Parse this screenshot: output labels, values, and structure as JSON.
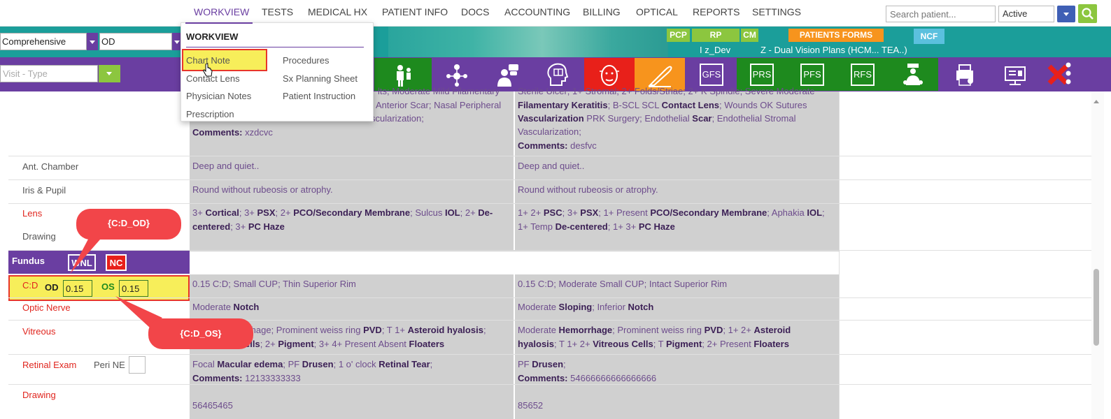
{
  "nav": {
    "items": [
      "WORKVIEW",
      "TESTS",
      "MEDICAL HX",
      "PATIENT INFO",
      "DOCS",
      "ACCOUNTING",
      "BILLING",
      "OPTICAL",
      "REPORTS",
      "SETTINGS"
    ],
    "search_placeholder": "Search patient...",
    "status_value": "Active"
  },
  "header": {
    "exam_type": "Comprehensive",
    "eye": "OD",
    "badges": {
      "pcp": "PCP",
      "rp": "RP",
      "cm": "CM",
      "forms": "PATIENTS FORMS",
      "ncf": "NCF"
    },
    "provider": "I z_Dev",
    "plan": "Z - Dual Vision Plans (HCM... TEA..)",
    "visit_type_placeholder": "Visit - Type"
  },
  "toolbar": {
    "gfs": "GFS",
    "prs": "PRS",
    "pfs": "PFS",
    "rfs": "RFS",
    "colors": {
      "green": "#1e8a1e",
      "red": "#e8201a",
      "orange": "#f7941d",
      "purple": "#6a3ea1"
    }
  },
  "dropdown": {
    "title": "WORKVIEW",
    "left": [
      "Chart Note",
      "Contact Lens",
      "Physician Notes",
      "Prescription"
    ],
    "right": [
      "Procedures",
      "Sx Planning Sheet",
      "Patient Instruction"
    ]
  },
  "exam": {
    "top_left_line1": "lts; Moderate Mild Filamentary",
    "top_left_line2": "Anterior Scar; Nasal Peripheral",
    "top_left_line3": "scularization;",
    "top_left_comments_label": "Comments:",
    "top_left_comments": "xzdcvc",
    "top_right_line1": "Sterile Ulcer; 1+ Stromal; 2+ Folds/Striae; 2+ K Spindle; Severe Moderate",
    "top_right_line2a": "Filamentary Keratitis",
    "top_right_line2b": "; B-SCL SCL ",
    "top_right_line2c": "Contact Lens",
    "top_right_line2d": "; Wounds OK Sutures",
    "top_right_line3a": "Vascularization",
    "top_right_line3b": " PRK Surgery; Endothelial ",
    "top_right_line3c": "Scar",
    "top_right_line3d": "; Endothelial Stromal",
    "top_right_line4": "Vascularization;",
    "top_right_comments_label": "Comments:",
    "top_right_comments": "desfvc",
    "ant_chamber_label": "Ant. Chamber",
    "ant_chamber_od": "Deep and quiet..",
    "ant_chamber_os": "Deep and quiet..",
    "iris_label": "Iris & Pupil",
    "iris_od": "Round without rubeosis or atrophy.",
    "iris_os": "Round without rubeosis or atrophy.",
    "lens_label": "Lens",
    "drawing_label": "Drawing",
    "fundus_label": "Fundus",
    "wnl": "WNL",
    "nc": "NC",
    "cd_label": "C:D",
    "cd_od_label": "OD",
    "cd_od_value": "0.15",
    "cd_os_label": "OS",
    "cd_os_value": "0.15",
    "cd_od_text": "0.15 C:D; Small CUP; Thin Superior Rim",
    "cd_os_text": "0.15 C:D; Moderate Small CUP; Intact Superior Rim",
    "optic_label": "Optic Nerve",
    "vitreous_label": "Vitreous",
    "retinal_label": "Retinal Exam",
    "peri_ne": "Peri NE",
    "drawing2_label": "Drawing",
    "drawing_od": "56465465",
    "drawing_os": "85652",
    "retinal_od_comments": "12133333333",
    "retinal_os_comments": "54666666666666666"
  },
  "callouts": {
    "od": "{C:D_OD}",
    "os": "{C:D_OS}"
  }
}
